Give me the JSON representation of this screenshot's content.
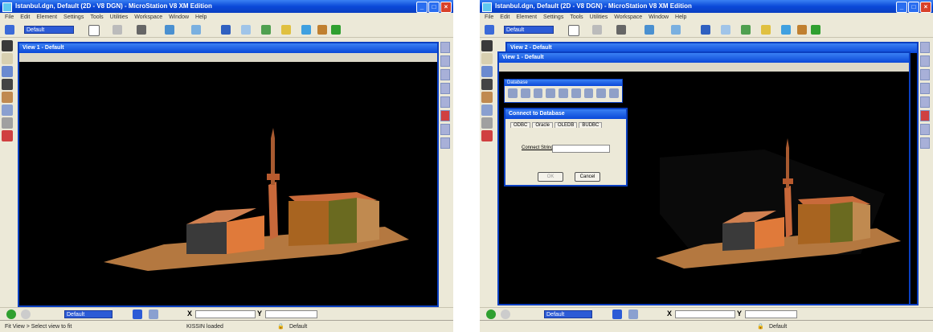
{
  "left": {
    "title": "Istanbul.dgn, Default (2D - V8 DGN) - MicroStation V8 XM Edition",
    "menu": [
      "File",
      "Edit",
      "Element",
      "Settings",
      "Tools",
      "Utilities",
      "Workspace",
      "Window",
      "Help"
    ],
    "level_select": "Default",
    "view_title": "View 1 - Default",
    "active_level": "Default",
    "coord_x_label": "X",
    "coord_y_label": "Y",
    "status_prompt": "Fit View > Select view to fit",
    "status_message": "KISSIN loaded",
    "status_level": "Default"
  },
  "right": {
    "title": "Istanbul.dgn, Default (2D - V8 DGN) - MicroStation V8 XM Edition",
    "menu": [
      "File",
      "Edit",
      "Element",
      "Settings",
      "Tools",
      "Utilities",
      "Workspace",
      "Window",
      "Help"
    ],
    "level_select": "Default",
    "view2_title": "View 2 - Default",
    "view1_title": "View 1 - Default",
    "db_toolbar_title": "Database",
    "dialog_title": "Connect to Database",
    "tabs": [
      "ODBC",
      "Oracle",
      "OLEDB",
      "BUDBC"
    ],
    "connect_label": "Connect String",
    "ok_label": "OK",
    "cancel_label": "Cancel",
    "active_level": "Default",
    "coord_x_label": "X",
    "coord_y_label": "Y",
    "status_level": "Default"
  },
  "colors": {
    "title_blue": "#0a48d8",
    "chrome": "#ece9d8",
    "viewport": "#000000"
  }
}
